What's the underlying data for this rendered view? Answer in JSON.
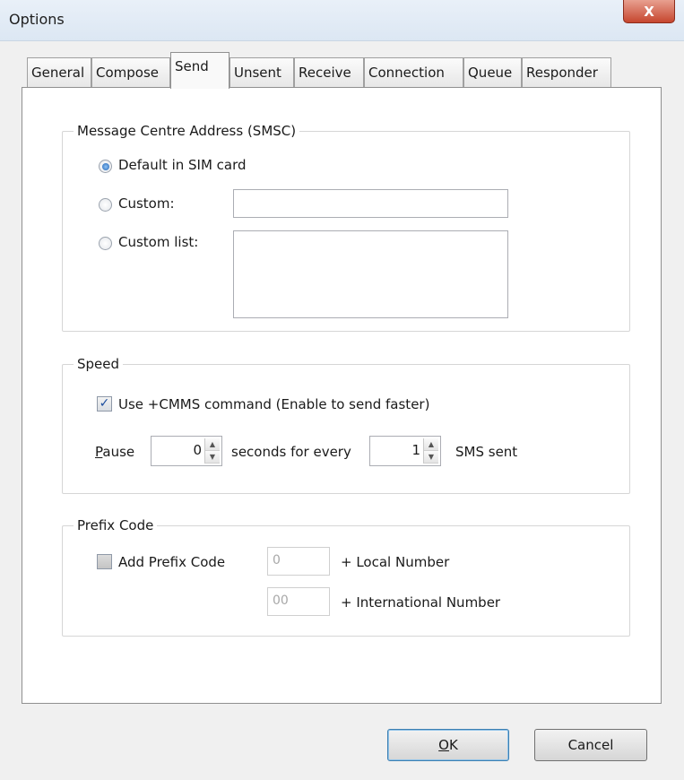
{
  "window": {
    "title": "Options",
    "close_label": "X"
  },
  "tabs": [
    {
      "label": "General"
    },
    {
      "label": "Compose"
    },
    {
      "label": "Send"
    },
    {
      "label": "Unsent"
    },
    {
      "label": "Receive"
    },
    {
      "label": "Connection"
    },
    {
      "label": "Queue"
    },
    {
      "label": "Responder"
    }
  ],
  "active_tab": "Send",
  "smsc": {
    "group_label": "Message Centre Address (SMSC)",
    "default_label": "Default in SIM card",
    "custom_label": "Custom:",
    "custom_list_label": "Custom list:",
    "custom_value": "",
    "selected": "Default in SIM card"
  },
  "speed": {
    "group_label": "Speed",
    "cmms_label": "Use +CMMS command (Enable to send faster)",
    "cmms_checked": true,
    "pause_label": "Pause",
    "pause_value": "0",
    "seconds_label": "seconds for every",
    "count_value": "1",
    "sms_sent_label": "SMS sent"
  },
  "prefix": {
    "group_label": "Prefix Code",
    "add_label": "Add Prefix Code",
    "add_checked": false,
    "local_value": "0",
    "local_label": "+ Local Number",
    "intl_value": "00",
    "intl_label": "+ International Number"
  },
  "buttons": {
    "ok": "OK",
    "cancel": "Cancel"
  },
  "colors": {
    "accent": "#1f62b5",
    "close": "#c6462f"
  }
}
